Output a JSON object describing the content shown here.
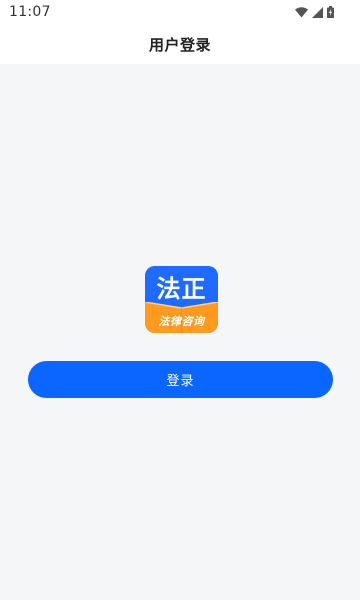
{
  "status_bar": {
    "time": "11:07",
    "icons": [
      "wifi-icon",
      "cellular-signal-icon",
      "battery-icon"
    ]
  },
  "header": {
    "title": "用户登录"
  },
  "logo": {
    "main_text": "法正",
    "sub_text": "法律咨询"
  },
  "login": {
    "button_label": "登录"
  },
  "colors": {
    "primary": "#0a66ff",
    "logo_blue": "#1f6bff",
    "logo_orange": "#ff9a1f",
    "background": "#f5f6f8",
    "header_bg": "#ffffff"
  }
}
